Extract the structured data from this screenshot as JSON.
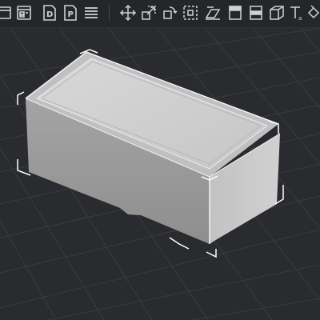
{
  "toolbar": {
    "left_group": [
      {
        "icon": "window-icon",
        "tooltip": ""
      },
      {
        "icon": "layout-icon",
        "tooltip": ""
      },
      {
        "icon": "document-d-icon",
        "tooltip": ""
      },
      {
        "icon": "document-p-icon",
        "tooltip": ""
      },
      {
        "icon": "layers-list-icon",
        "tooltip": ""
      }
    ],
    "right_group": [
      {
        "icon": "move-icon"
      },
      {
        "icon": "scale-icon"
      },
      {
        "icon": "rotate-icon"
      },
      {
        "icon": "box-select-icon"
      },
      {
        "icon": "flip-icon"
      },
      {
        "icon": "align-top-icon"
      },
      {
        "icon": "align-middle-icon"
      },
      {
        "icon": "align-bottom-icon"
      },
      {
        "icon": "cube-icon"
      },
      {
        "icon": "cube-outline-icon"
      },
      {
        "icon": "text-icon"
      },
      {
        "icon": "fill-bucket-icon"
      }
    ]
  },
  "colors": {
    "background": "#2a2b2f",
    "grid": "#3a3b40",
    "box_side_front": "#9e9e9e",
    "box_side_right": "#c8c8c8",
    "box_top": "#d2d2d2",
    "selection": "#ffffff",
    "icon": "#cfd0d2"
  },
  "scene": {
    "object": "rectangular-container",
    "selected": true,
    "view": "perspective"
  }
}
